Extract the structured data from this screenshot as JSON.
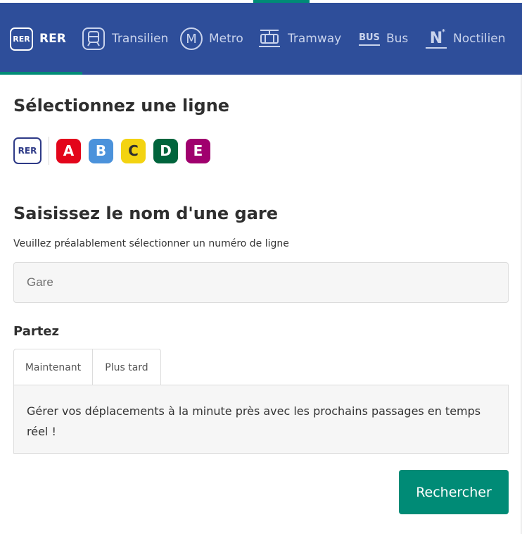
{
  "modes": [
    {
      "key": "rer",
      "label": "RER",
      "icon": "rer-icon",
      "icon_text": "RER",
      "active": true
    },
    {
      "key": "transilien",
      "label": "Transilien",
      "icon": "train-icon",
      "active": false
    },
    {
      "key": "metro",
      "label": "Metro",
      "icon": "metro-icon",
      "icon_text": "M",
      "active": false
    },
    {
      "key": "tramway",
      "label": "Tramway",
      "icon": "tram-icon",
      "active": false
    },
    {
      "key": "bus",
      "label": "Bus",
      "icon": "bus-icon",
      "icon_text": "BUS",
      "active": false
    },
    {
      "key": "noctilien",
      "label": "Noctilien",
      "icon": "noctilien-icon",
      "icon_text": "N",
      "icon_sup": "*",
      "active": false
    }
  ],
  "line_section": {
    "title": "Sélectionnez une ligne",
    "network_logo_text": "RER",
    "lines": [
      {
        "label": "A",
        "color": "#e3051b"
      },
      {
        "label": "B",
        "color": "#4b92db"
      },
      {
        "label": "C",
        "color": "#f3d311"
      },
      {
        "label": "D",
        "color": "#00643c"
      },
      {
        "label": "E",
        "color": "#a0006e"
      }
    ]
  },
  "station_section": {
    "title": "Saisissez le nom d'une gare",
    "hint": "Veuillez préalablement sélectionner un numéro de ligne",
    "placeholder": "Gare"
  },
  "departure": {
    "label": "Partez",
    "tabs": [
      "Maintenant",
      "Plus tard"
    ],
    "active_tab": "Maintenant",
    "panel_text": "Gérer vos déplacements à la minute près avec les prochains passages en temps réel !"
  },
  "search_label": "Rechercher",
  "colors": {
    "brand_blue": "#2e4e9a",
    "accent_green": "#008b76"
  }
}
